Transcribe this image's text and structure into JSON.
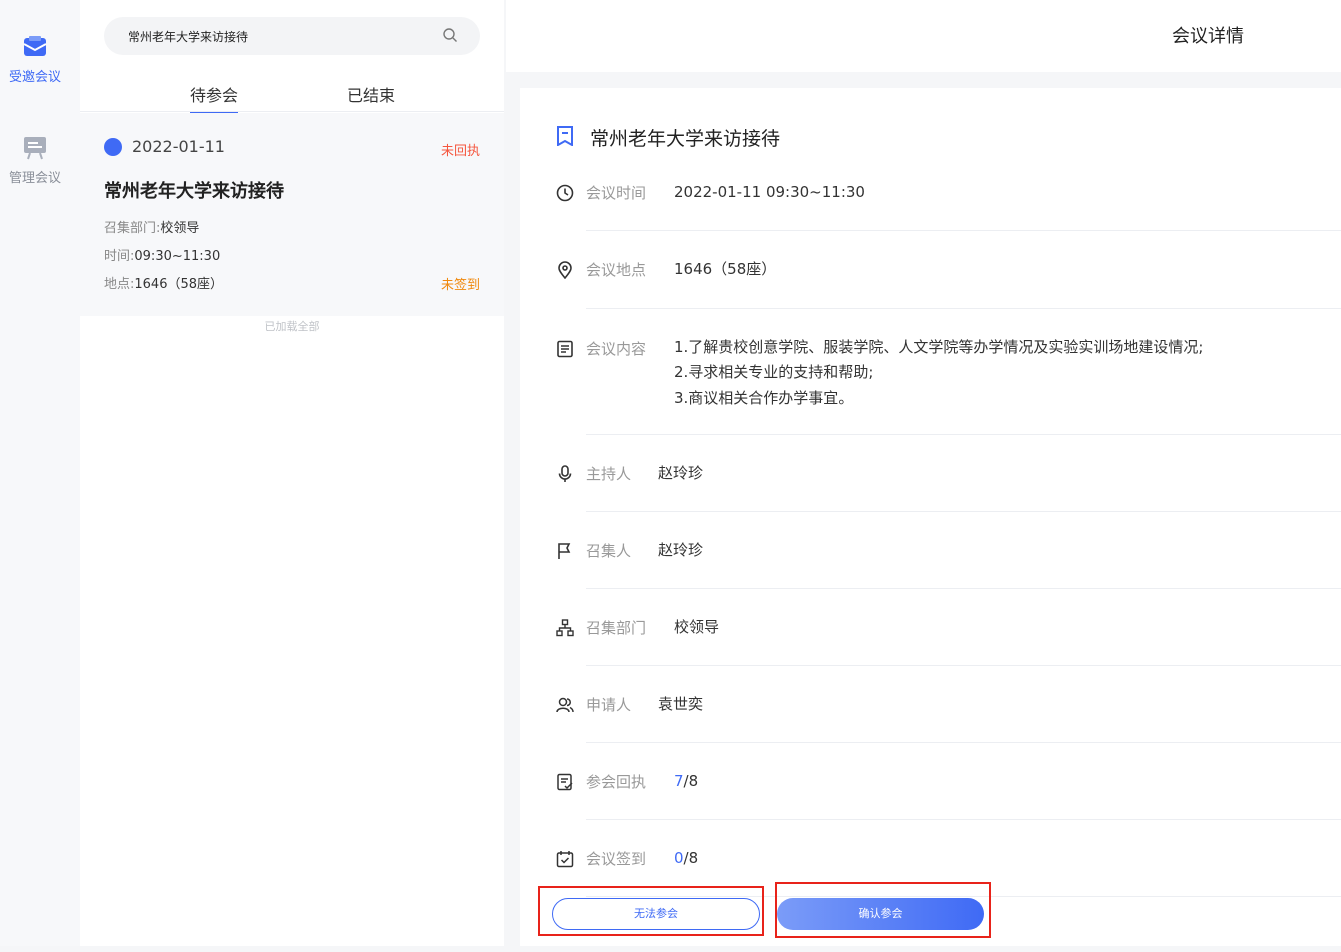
{
  "nav": {
    "items": [
      {
        "label": "受邀会议",
        "icon": "mail-check-icon",
        "active": true
      },
      {
        "label": "管理会议",
        "icon": "presentation-board-icon",
        "active": false
      }
    ]
  },
  "list": {
    "search_value": "常州老年大学来访接待",
    "tabs": [
      {
        "label": "待参会",
        "active": true
      },
      {
        "label": "已结束",
        "active": false
      }
    ],
    "items": [
      {
        "date": "2022-01-11",
        "reply_status": "未回执",
        "title": "常州老年大学来访接待",
        "dept_key": "召集部门:",
        "dept_val": "校领导",
        "time_key": "时间:",
        "time_val": "09:30~11:30",
        "place_key": "地点:",
        "place_val": "1646（58座）",
        "signin_status": "未签到"
      }
    ],
    "footer": "已加载全部"
  },
  "detail": {
    "header_title": "会议详情",
    "title": "常州老年大学来访接待",
    "time_label": "会议时间",
    "time_value": "2022-01-11 09:30~11:30",
    "place_label": "会议地点",
    "place_value": "1646（58座）",
    "content_label": "会议内容",
    "content_lines": [
      "1.了解贵校创意学院、服装学院、人文学院等办学情况及实验实训场地建设情况;",
      "2.寻求相关专业的支持和帮助;",
      "3.商议相关合作办学事宜。"
    ],
    "host_label": "主持人",
    "host_value": "赵玲珍",
    "convener_label": "召集人",
    "convener_value": "赵玲珍",
    "dept_label": "召集部门",
    "dept_value": "校领导",
    "applicant_label": "申请人",
    "applicant_value": "袁世奕",
    "reply_label": "参会回执",
    "reply_count": "7",
    "reply_total": "/8",
    "signin_label": "会议签到",
    "signin_count": "0",
    "signin_total": "/8"
  },
  "actions": {
    "decline_label": "无法参会",
    "confirm_label": "确认参会"
  },
  "colors": {
    "accent": "#3f6af5",
    "warn_red": "#f5563e",
    "warn_orange": "#f0890e",
    "highlight_frame": "#e8231a"
  }
}
